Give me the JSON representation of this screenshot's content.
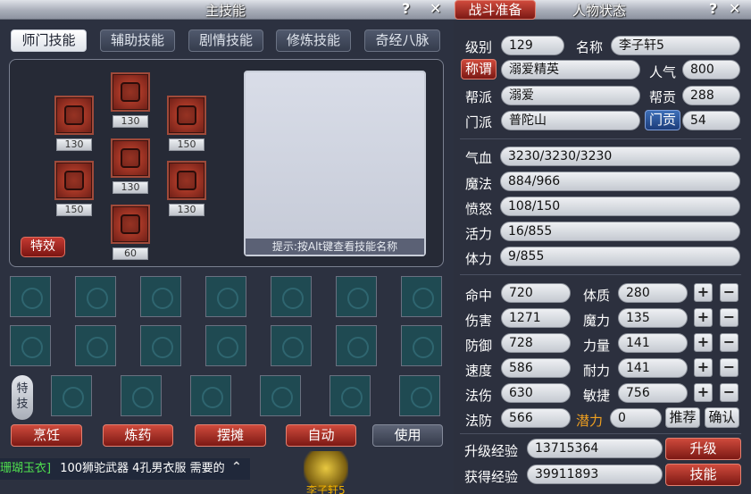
{
  "left": {
    "title": "主技能",
    "tabs": [
      {
        "label": "师门技能"
      },
      {
        "label": "辅助技能"
      },
      {
        "label": "剧情技能"
      },
      {
        "label": "修炼技能"
      },
      {
        "label": "奇经八脉"
      }
    ],
    "skill_levels": [
      "130",
      "130",
      "150",
      "130",
      "150",
      "130",
      "60"
    ],
    "preview_hint": "提示:按Alt键查看技能名称",
    "effect_button": "特效",
    "special_label": "特技",
    "actions": [
      "烹饪",
      "炼药",
      "摆摊",
      "自动",
      "使用"
    ],
    "chat": {
      "prefix": "珊瑚玉衣]",
      "message": "100狮驼武器 4孔男衣服 需要的"
    },
    "character_name": "李子轩5"
  },
  "right": {
    "tab_battle": "战斗准备",
    "title": "人物状态",
    "level": {
      "label": "级别",
      "value": "129"
    },
    "name": {
      "label": "名称",
      "value": "李子轩5"
    },
    "honor": {
      "label": "称谓",
      "value": "溺爱精英"
    },
    "popularity": {
      "label": "人气",
      "value": "800"
    },
    "guild": {
      "label": "帮派",
      "value": "溺爱"
    },
    "guild_contrib": {
      "label": "帮贡",
      "value": "288"
    },
    "sect": {
      "label": "门派",
      "value": "普陀山"
    },
    "sect_contrib": {
      "label": "门贡",
      "value": "54"
    },
    "hp": {
      "label": "气血",
      "value": "3230/3230/3230"
    },
    "mp": {
      "label": "魔法",
      "value": "884/966"
    },
    "anger": {
      "label": "愤怒",
      "value": "108/150"
    },
    "vitality": {
      "label": "活力",
      "value": "16/855"
    },
    "stamina": {
      "label": "体力",
      "value": "9/855"
    },
    "hit": {
      "label": "命中",
      "value": "720"
    },
    "damage": {
      "label": "伤害",
      "value": "1271"
    },
    "defense": {
      "label": "防御",
      "value": "728"
    },
    "speed": {
      "label": "速度",
      "value": "586"
    },
    "spell_dmg": {
      "label": "法伤",
      "value": "630"
    },
    "spell_def": {
      "label": "法防",
      "value": "566"
    },
    "constitution": {
      "label": "体质",
      "value": "280"
    },
    "magic": {
      "label": "魔力",
      "value": "135"
    },
    "strength": {
      "label": "力量",
      "value": "141"
    },
    "endurance": {
      "label": "耐力",
      "value": "141"
    },
    "agility": {
      "label": "敏捷",
      "value": "756"
    },
    "potential": {
      "label": "潜力",
      "value": "0"
    },
    "recommend": "推荐",
    "confirm": "确认",
    "upgrade_exp": {
      "label": "升级经验",
      "value": "13715364"
    },
    "gained_exp": {
      "label": "获得经验",
      "value": "39911893"
    },
    "btn_upgrade": "升级",
    "btn_skills": "技能"
  }
}
